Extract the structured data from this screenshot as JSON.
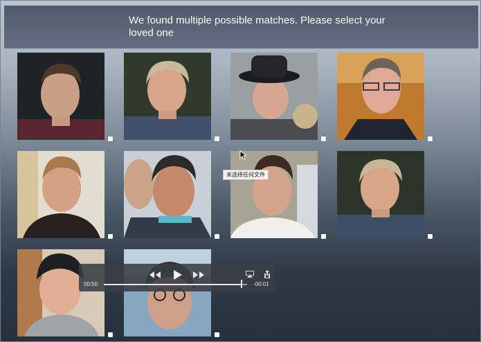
{
  "header": {
    "title": "We found multiple possible matches. Please select your loved one"
  },
  "photos": [
    {
      "label": "match-1",
      "selected": false
    },
    {
      "label": "match-2",
      "selected": false
    },
    {
      "label": "match-3",
      "selected": false
    },
    {
      "label": "match-4",
      "selected": false
    },
    {
      "label": "match-5",
      "selected": false
    },
    {
      "label": "match-6",
      "selected": false
    },
    {
      "label": "match-7",
      "selected": false
    },
    {
      "label": "match-8",
      "selected": false
    },
    {
      "label": "match-9",
      "selected": false
    },
    {
      "label": "match-10",
      "selected": false
    }
  ],
  "tooltip": {
    "text": "未选择任何文件"
  },
  "player": {
    "elapsed": "00:50",
    "remaining": "-00:01",
    "progress": 0.96,
    "icons": {
      "rewind": "rewind-icon",
      "play": "play-icon",
      "forward": "fast-forward-icon",
      "airplay": "airplay-icon",
      "share": "share-icon"
    }
  }
}
